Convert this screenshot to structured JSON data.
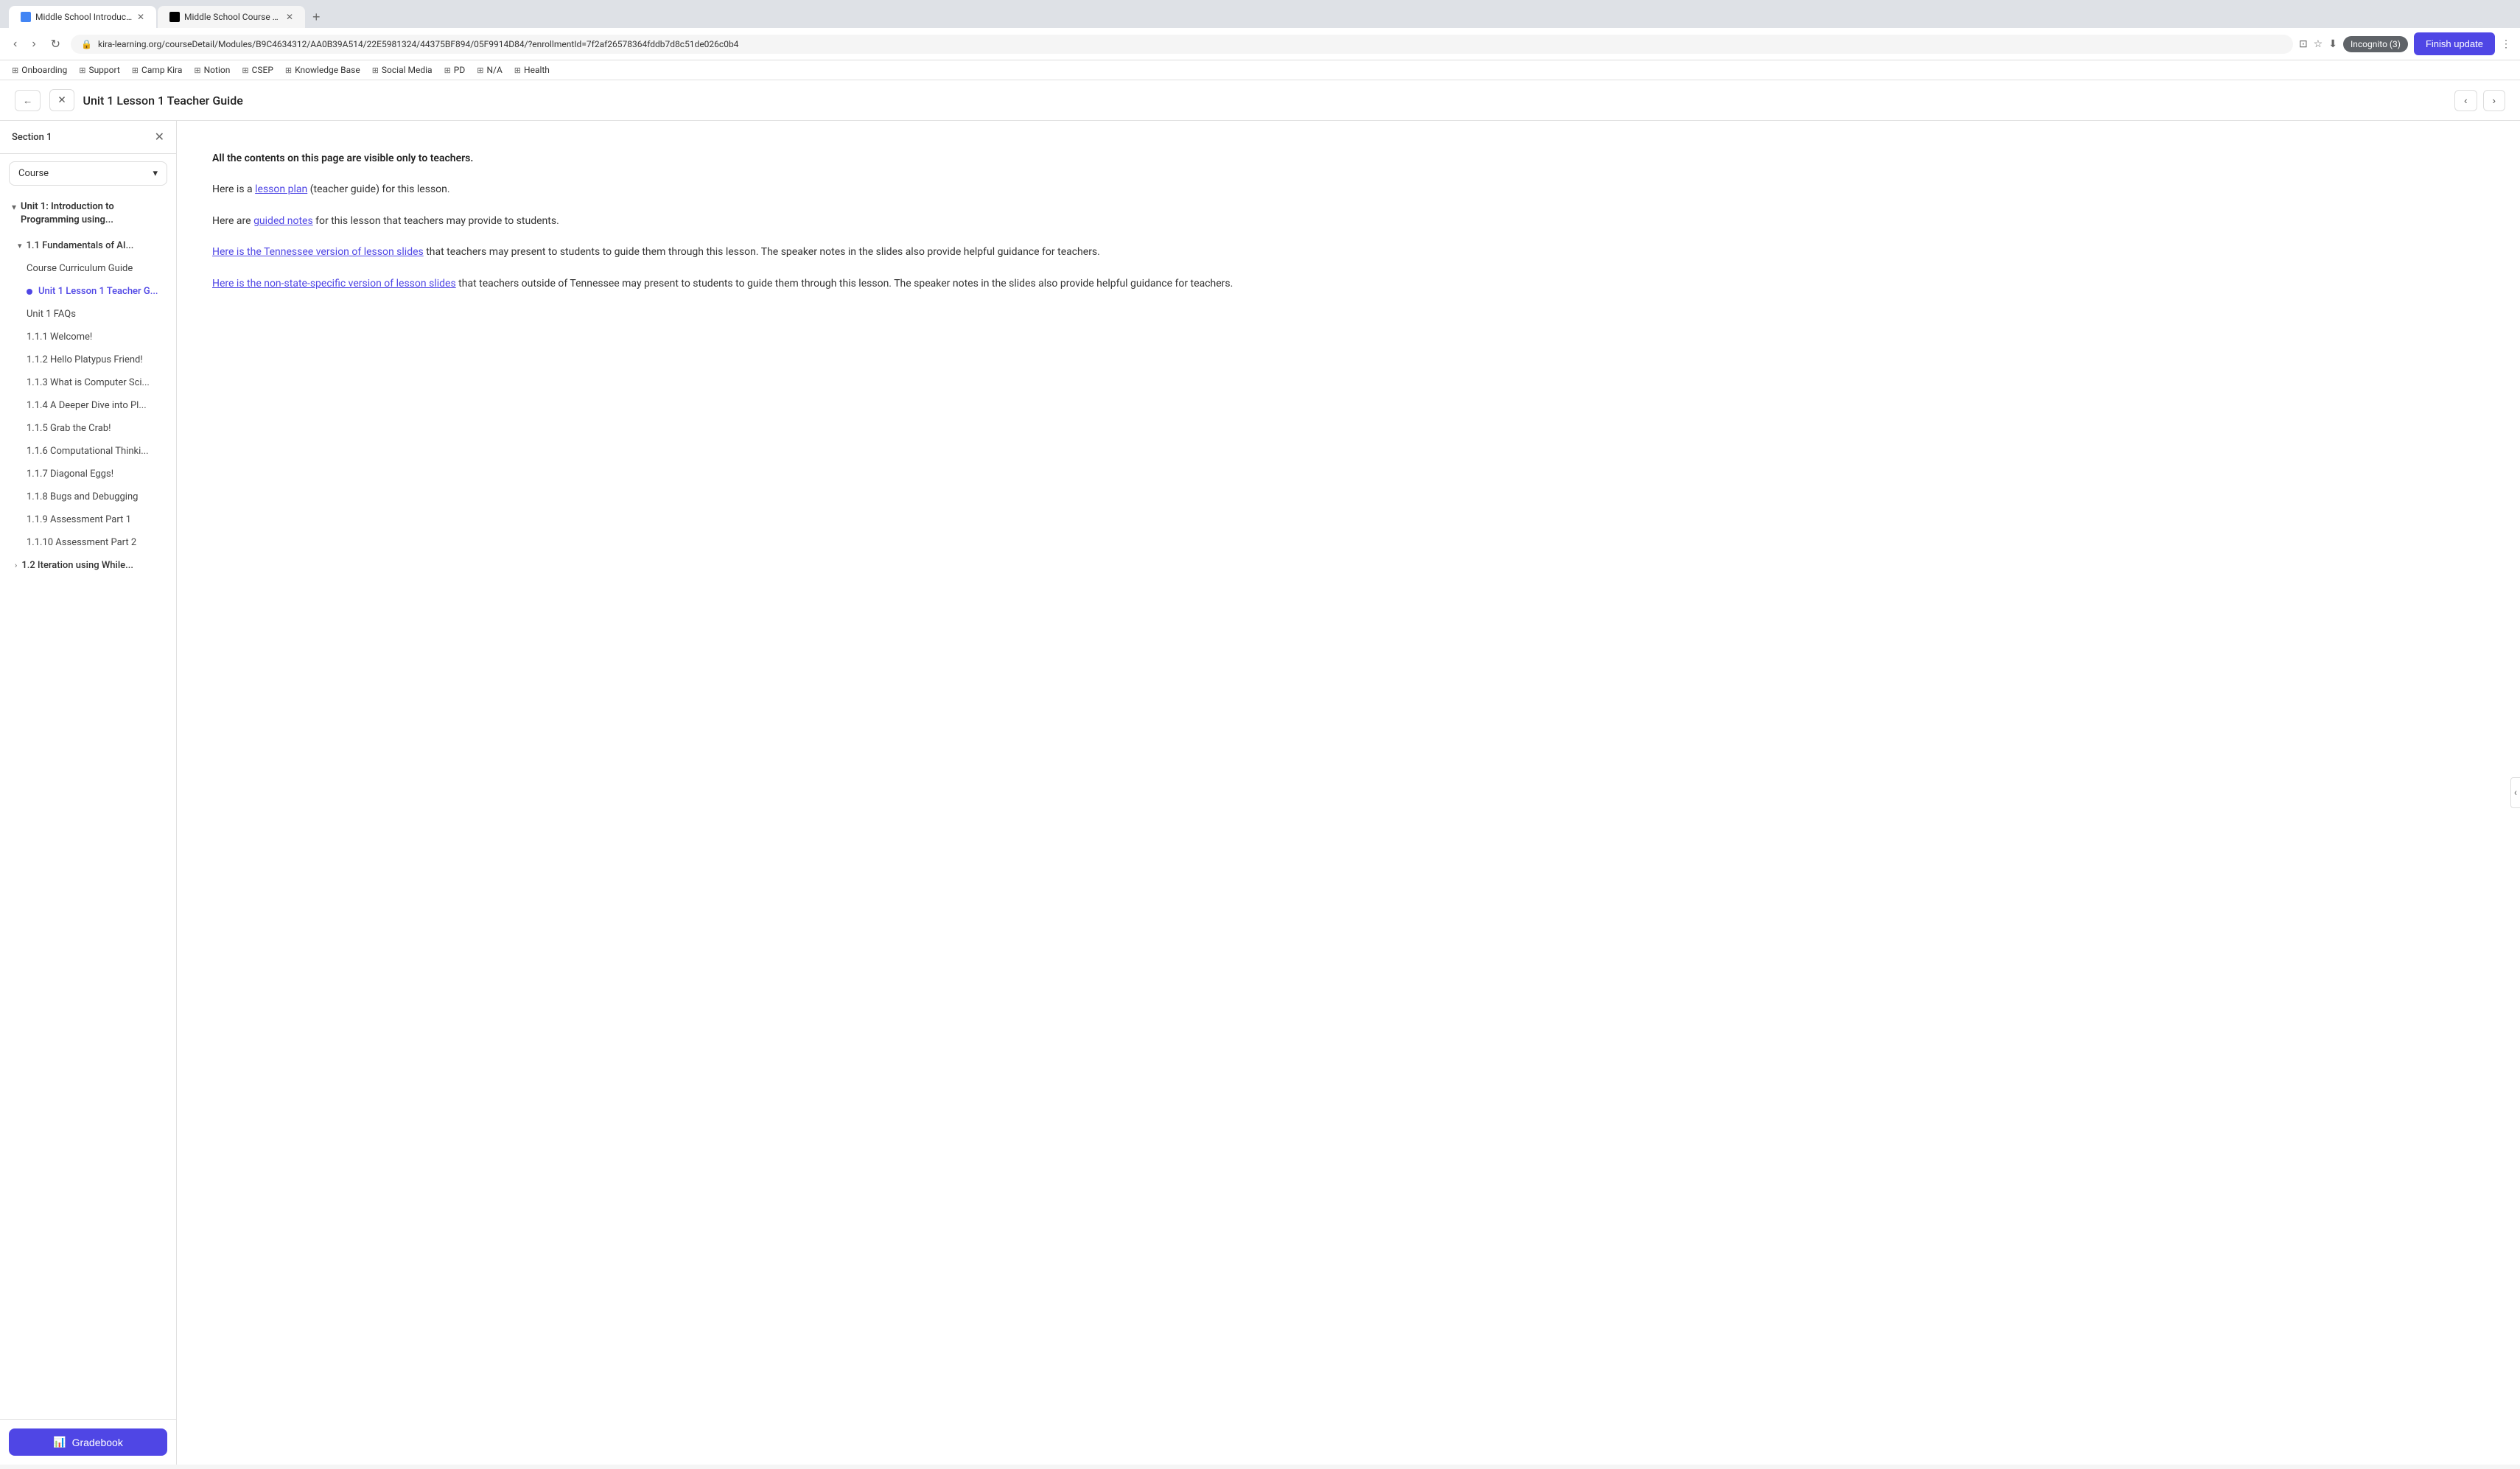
{
  "browser": {
    "tabs": [
      {
        "id": "tab1",
        "label": "Middle School Introduction t...",
        "active": true,
        "faviconType": "kira"
      },
      {
        "id": "tab2",
        "label": "Middle School Course Curric...",
        "active": false,
        "faviconType": "notion"
      }
    ],
    "url": "kira-learning.org/courseDetail/Modules/B9C4634312/AA0B39A514/22E5981324/44375BF894/05F9914D84/?enrollmentId=7f2af26578364fddb7d8c51de026c0b4",
    "incognito_label": "Incognito (3)",
    "finish_update_label": "Finish update"
  },
  "bookmarks": [
    {
      "label": "Onboarding"
    },
    {
      "label": "Support"
    },
    {
      "label": "Camp Kira"
    },
    {
      "label": "Notion"
    },
    {
      "label": "CSEP"
    },
    {
      "label": "Knowledge Base"
    },
    {
      "label": "Social Media"
    },
    {
      "label": "PD"
    },
    {
      "label": "N/A"
    },
    {
      "label": "Health"
    }
  ],
  "toolbar": {
    "page_title": "Unit 1 Lesson 1 Teacher Guide"
  },
  "sidebar": {
    "section_label": "Section 1",
    "dropdown_label": "Course",
    "unit1": {
      "title": "Unit 1: Introduction to Programming using...",
      "sub_unit": {
        "title": "1.1 Fundamentals of AI...",
        "items": [
          {
            "label": "Course Curriculum Guide",
            "active": false
          },
          {
            "label": "Unit 1 Lesson 1 Teacher G...",
            "active": true
          },
          {
            "label": "Unit 1 FAQs",
            "active": false
          },
          {
            "label": "1.1.1 Welcome!",
            "active": false
          },
          {
            "label": "1.1.2 Hello Platypus Friend!",
            "active": false
          },
          {
            "label": "1.1.3 What is Computer Sci...",
            "active": false
          },
          {
            "label": "1.1.4 A Deeper Dive into Pl...",
            "active": false
          },
          {
            "label": "1.1.5 Grab the Crab!",
            "active": false
          },
          {
            "label": "1.1.6 Computational Thinki...",
            "active": false
          },
          {
            "label": "1.1.7 Diagonal Eggs!",
            "active": false
          },
          {
            "label": "1.1.8 Bugs and Debugging",
            "active": false
          },
          {
            "label": "1.1.9 Assessment Part 1",
            "active": false
          },
          {
            "label": "1.1.10 Assessment Part 2",
            "active": false
          }
        ]
      }
    },
    "unit2": {
      "title": "1.2 Iteration using While..."
    },
    "gradebook_label": "Gradebook"
  },
  "content": {
    "notice": "All the contents on this page are visible only to teachers.",
    "paragraph1_prefix": "Here is a ",
    "lesson_plan_link": "lesson plan",
    "paragraph1_suffix": " (teacher guide) for this lesson.",
    "paragraph2_prefix": "Here are ",
    "guided_notes_link": "guided notes",
    "paragraph2_suffix": " for this lesson that teachers may provide to students.",
    "paragraph3_link": "Here is the Tennessee version of lesson slides",
    "paragraph3_suffix": " that teachers may present to students to guide them through this lesson. The speaker notes in the slides also provide helpful guidance for teachers.",
    "paragraph4_link_text": "Here is the non-state-specific version of lesson slides",
    "paragraph4_suffix": " that teachers outside of Tennessee may present to students to guide them through this lesson. The speaker notes in the slides also provide helpful guidance for teachers."
  }
}
